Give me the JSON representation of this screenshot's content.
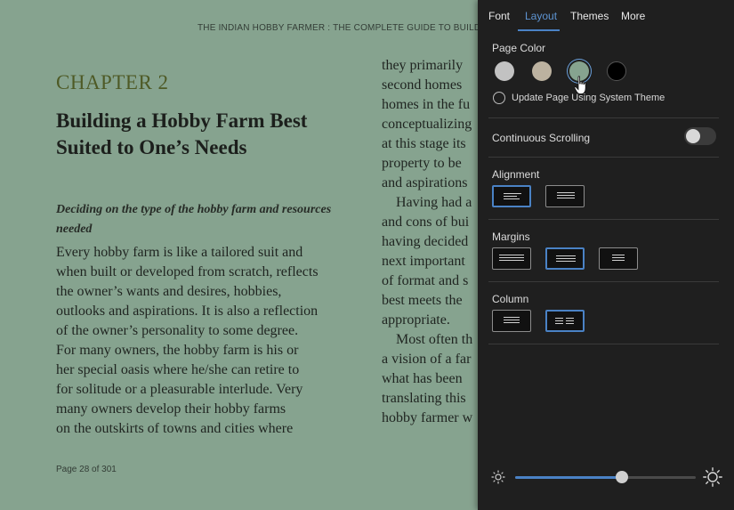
{
  "book": {
    "running_head": "THE INDIAN HOBBY FARMER : THE COMPLETE GUIDE TO BUILDING YOUR",
    "chapter_label": "CHAPTER 2",
    "chapter_title": "Building a Hobby Farm Best Suited to One’s Needs",
    "subtitle": "Deciding on the type of the hobby farm and resources needed",
    "column1_lines": [
      "Every hobby farm is like a tailored suit and",
      "when built or developed from scratch, reflects",
      "the owner’s wants and desires, hobbies,",
      "outlooks and aspirations. It is also a reflection",
      "of the owner’s personality to some degree.",
      "For many owners, the hobby farm is his or",
      "her special oasis where he/she can retire to",
      "for solitude or a pleasurable interlude. Very",
      "many owners develop their hobby farms",
      "on the outskirts of towns and cities where"
    ],
    "column2_lines": [
      "they primarily",
      "second homes",
      "homes in the fu",
      "conceptualizing",
      "at this stage its",
      "property to be",
      "and aspirations",
      "Having had a",
      "and cons of bui",
      "having decided",
      "next important",
      "of format and s",
      "best meets the",
      "appropriate.",
      "Most often th",
      "a vision of a far",
      "what has been",
      "translating this",
      "hobby farmer w"
    ],
    "page_indicator": "Page 28 of 301"
  },
  "panel": {
    "tabs": [
      {
        "label": "Font"
      },
      {
        "label": "Layout"
      },
      {
        "label": "Themes"
      },
      {
        "label": "More"
      }
    ],
    "active_tab": "Layout",
    "page_color": {
      "label": "Page Color",
      "swatches": [
        "#c2c2c2",
        "#bcb2a0",
        "#86a38f",
        "#000000"
      ],
      "selected_index": 2,
      "system_theme_label": "Update Page Using System Theme",
      "system_theme_checked": false
    },
    "continuous_scrolling": {
      "label": "Continuous Scrolling",
      "enabled": false
    },
    "alignment": {
      "label": "Alignment",
      "options": [
        "left",
        "justified"
      ],
      "selected_index": 0
    },
    "margins": {
      "label": "Margins",
      "options": [
        "narrow",
        "medium",
        "wide"
      ],
      "selected_index": 1
    },
    "column": {
      "label": "Column",
      "options": [
        "single",
        "double"
      ],
      "selected_index": 1
    },
    "brightness": {
      "value": 0.59
    },
    "accent_color": "#4a82c5"
  }
}
